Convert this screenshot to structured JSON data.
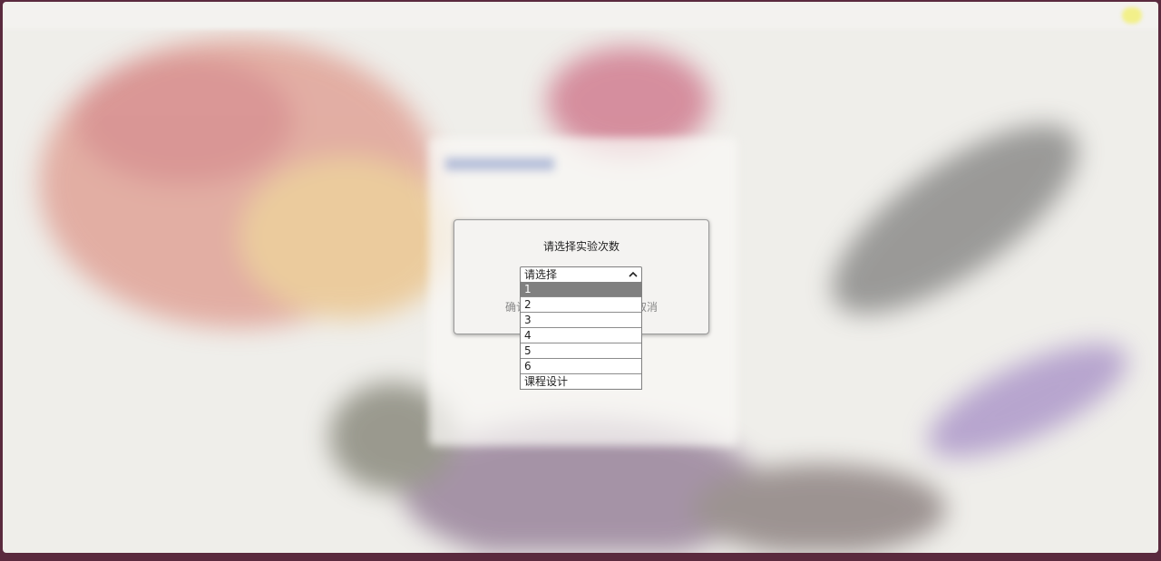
{
  "dialog": {
    "title": "请选择实验次数",
    "confirm_label": "确认",
    "cancel_label": "取消"
  },
  "select": {
    "current_value": "请选择",
    "options": [
      "1",
      "2",
      "3",
      "4",
      "5",
      "6",
      "课程设计"
    ],
    "highlighted_option": "1"
  },
  "icons": {
    "select_toggle": "chevron-up-icon"
  },
  "colors": {
    "highlight": "#808080",
    "modal_bg": "#f4f3f1",
    "desktop_bg": "#5a2a3e"
  }
}
